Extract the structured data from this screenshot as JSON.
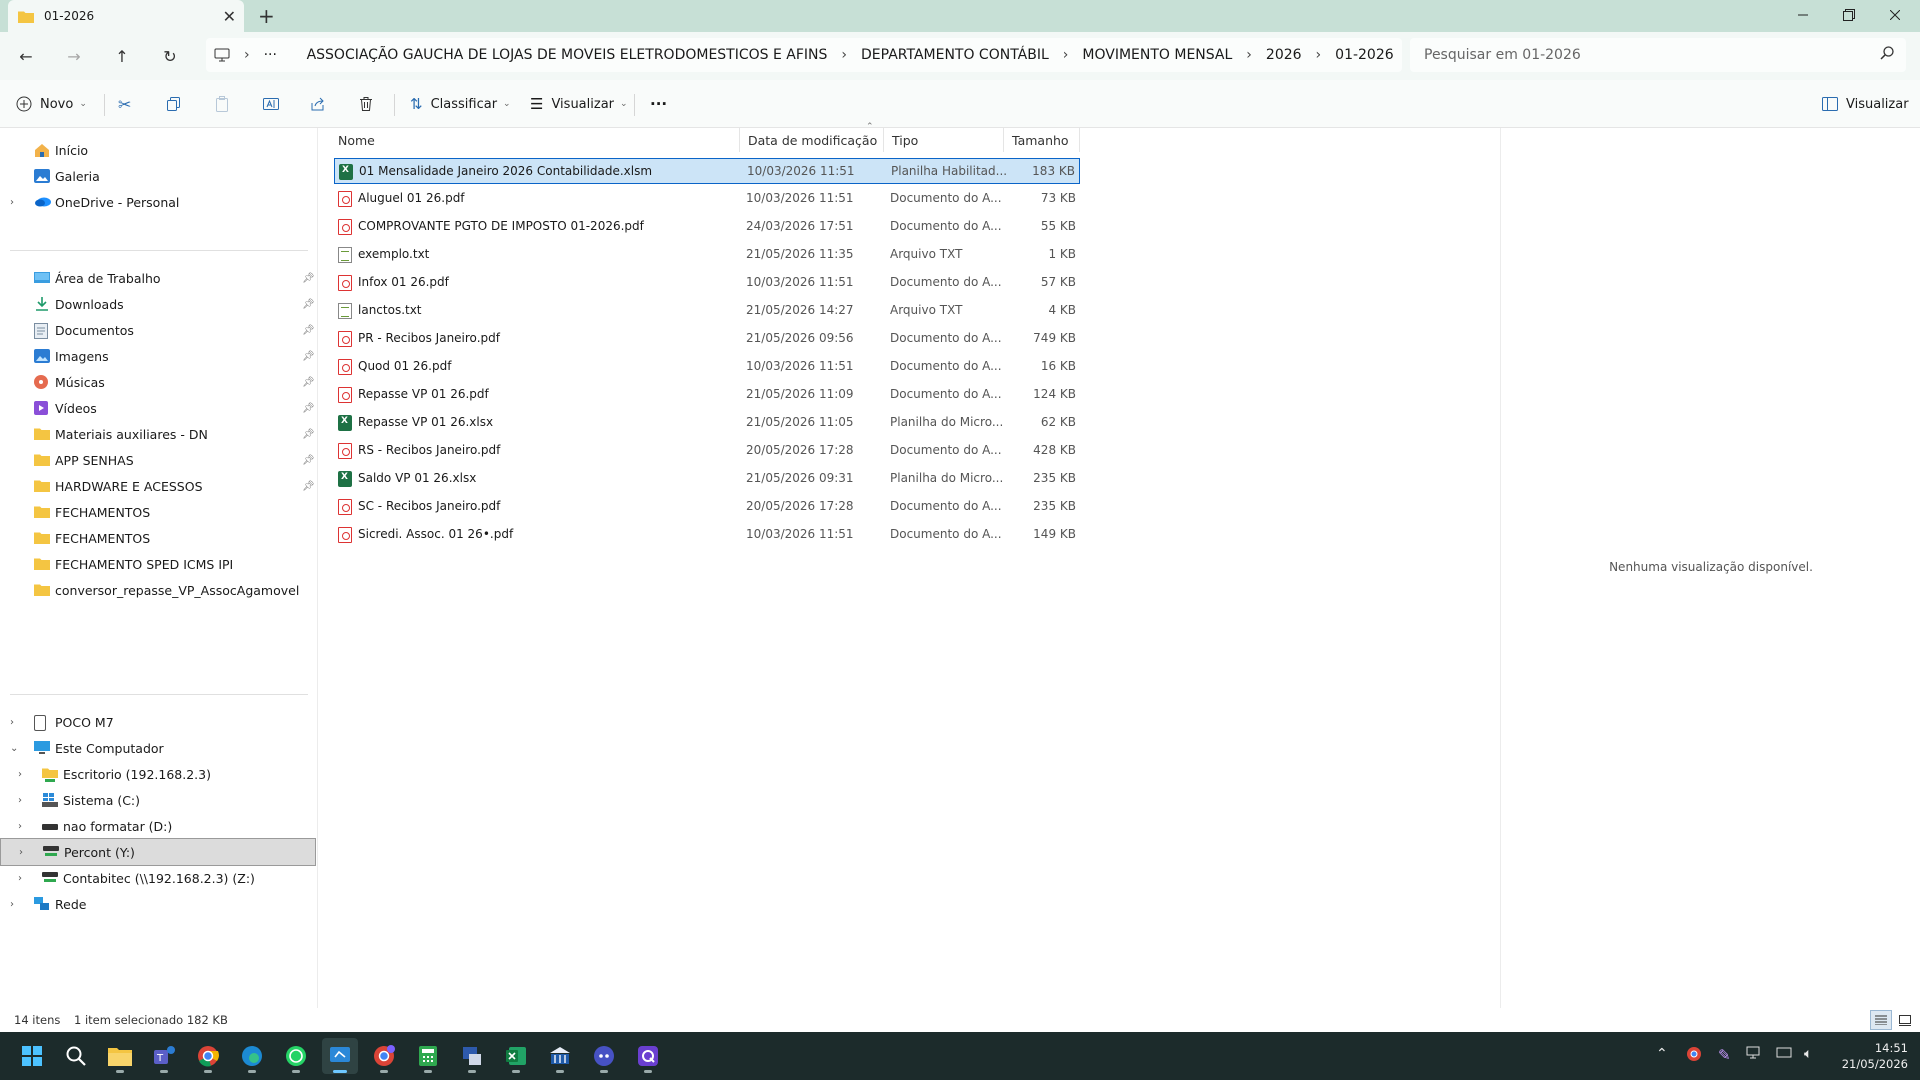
{
  "tab": {
    "title": "01-2026"
  },
  "address": {
    "crumbs": [
      "ASSOCIAÇÃO GAUCHA DE LOJAS DE MOVEIS ELETRODOMESTICOS E AFINS",
      "DEPARTAMENTO CONTÁBIL",
      "MOVIMENTO MENSAL",
      "2026",
      "01-2026"
    ],
    "ellipsis": "···"
  },
  "search": {
    "placeholder": "Pesquisar em 01-2026"
  },
  "toolbar": {
    "new_label": "Novo",
    "sort_label": "Classificar",
    "view_label": "Visualizar",
    "more_label": "···",
    "preview_label": "Visualizar"
  },
  "sidebar": {
    "top": [
      {
        "label": "Início",
        "icon": "home-icon"
      },
      {
        "label": "Galeria",
        "icon": "gallery-icon"
      },
      {
        "label": "OneDrive - Personal",
        "icon": "onedrive-icon"
      }
    ],
    "quick": [
      {
        "label": "Área de Trabalho",
        "icon": "desktop-icon",
        "pinned": true
      },
      {
        "label": "Downloads",
        "icon": "download-icon",
        "pinned": true
      },
      {
        "label": "Documentos",
        "icon": "documents-icon",
        "pinned": true
      },
      {
        "label": "Imagens",
        "icon": "pictures-icon",
        "pinned": true
      },
      {
        "label": "Músicas",
        "icon": "music-icon",
        "pinned": true
      },
      {
        "label": "Vídeos",
        "icon": "videos-icon",
        "pinned": true
      },
      {
        "label": "Materiais auxiliares - DN",
        "icon": "folder-icon",
        "pinned": true
      },
      {
        "label": "APP SENHAS",
        "icon": "folder-icon",
        "pinned": true
      },
      {
        "label": "HARDWARE E ACESSOS",
        "icon": "folder-icon",
        "pinned": true
      },
      {
        "label": "FECHAMENTOS",
        "icon": "folder-icon",
        "pinned": false
      },
      {
        "label": "FECHAMENTOS",
        "icon": "folder-icon",
        "pinned": false
      },
      {
        "label": "FECHAMENTO SPED ICMS IPI",
        "icon": "folder-icon",
        "pinned": false
      },
      {
        "label": "conversor_repasse_VP_AssocAgamovel",
        "icon": "folder-icon",
        "pinned": false
      }
    ],
    "devices": [
      {
        "label": "POCO M7",
        "icon": "phone-icon",
        "level": 0,
        "expander": "›"
      },
      {
        "label": "Este Computador",
        "icon": "computer-icon",
        "level": 0,
        "expander": "⌄"
      },
      {
        "label": "Escritorio (192.168.2.3)",
        "icon": "network-folder-icon",
        "level": 1,
        "expander": "›"
      },
      {
        "label": "Sistema (C:)",
        "icon": "windows-drive-icon",
        "level": 1,
        "expander": "›"
      },
      {
        "label": "nao formatar (D:)",
        "icon": "drive-icon",
        "level": 1,
        "expander": "›"
      },
      {
        "label": "Percont (Y:)",
        "icon": "network-drive-icon",
        "level": 1,
        "expander": "›"
      },
      {
        "label": "Contabitec (\\\\192.168.2.3) (Z:)",
        "icon": "network-drive-icon",
        "level": 1,
        "expander": "›"
      },
      {
        "label": "Rede",
        "icon": "network-icon",
        "level": 0,
        "expander": "›"
      }
    ]
  },
  "columns": {
    "name": "Nome",
    "date": "Data de modificação",
    "type": "Tipo",
    "size": "Tamanho"
  },
  "files": [
    {
      "name": "01 Mensalidade Janeiro 2026 Contabilidade.xlsm",
      "date": "10/03/2026 11:51",
      "type": "Planilha Habilitad...",
      "size": "183 KB",
      "kind": "xls"
    },
    {
      "name": "Aluguel 01 26.pdf",
      "date": "10/03/2026 11:51",
      "type": "Documento do A...",
      "size": "73 KB",
      "kind": "pdf"
    },
    {
      "name": "COMPROVANTE PGTO DE IMPOSTO 01-2026.pdf",
      "date": "24/03/2026 17:51",
      "type": "Documento do A...",
      "size": "55 KB",
      "kind": "pdf"
    },
    {
      "name": "exemplo.txt",
      "date": "21/05/2026 11:35",
      "type": "Arquivo TXT",
      "size": "1 KB",
      "kind": "txt"
    },
    {
      "name": "Infox 01 26.pdf",
      "date": "10/03/2026 11:51",
      "type": "Documento do A...",
      "size": "57 KB",
      "kind": "pdf"
    },
    {
      "name": "lanctos.txt",
      "date": "21/05/2026 14:27",
      "type": "Arquivo TXT",
      "size": "4 KB",
      "kind": "txt"
    },
    {
      "name": "PR - Recibos Janeiro.pdf",
      "date": "21/05/2026 09:56",
      "type": "Documento do A...",
      "size": "749 KB",
      "kind": "pdf"
    },
    {
      "name": "Quod 01 26.pdf",
      "date": "10/03/2026 11:51",
      "type": "Documento do A...",
      "size": "16 KB",
      "kind": "pdf"
    },
    {
      "name": "Repasse VP 01 26.pdf",
      "date": "21/05/2026 11:09",
      "type": "Documento do A...",
      "size": "124 KB",
      "kind": "pdf"
    },
    {
      "name": "Repasse VP 01 26.xlsx",
      "date": "21/05/2026 11:05",
      "type": "Planilha do Micro...",
      "size": "62 KB",
      "kind": "xls"
    },
    {
      "name": "RS - Recibos Janeiro.pdf",
      "date": "20/05/2026 17:28",
      "type": "Documento do A...",
      "size": "428 KB",
      "kind": "pdf"
    },
    {
      "name": "Saldo VP 01 26.xlsx",
      "date": "21/05/2026 09:31",
      "type": "Planilha do Micro...",
      "size": "235 KB",
      "kind": "xls"
    },
    {
      "name": "SC - Recibos Janeiro.pdf",
      "date": "20/05/2026 17:28",
      "type": "Documento do A...",
      "size": "235 KB",
      "kind": "pdf"
    },
    {
      "name": "Sicredi. Assoc. 01 26•.pdf",
      "date": "10/03/2026 11:51",
      "type": "Documento do A...",
      "size": "149 KB",
      "kind": "pdf"
    }
  ],
  "preview": {
    "message": "Nenhuma visualização disponível."
  },
  "status": {
    "count": "14 itens",
    "selection": "1 item selecionado  182 KB"
  },
  "taskbar": {
    "apps": [
      "start-icon",
      "search-icon",
      "file-explorer-icon",
      "teams-icon",
      "chrome-icon",
      "edge-icon",
      "whatsapp-icon",
      "remote-desktop-icon",
      "chrome-profile-icon",
      "calculator-icon",
      "tax-program-icon",
      "excel-icon",
      "government-app-icon",
      "discord-icon",
      "app-q-icon"
    ],
    "active_app": "remote-desktop-icon",
    "time": "14:51",
    "date": "21/05/2026"
  },
  "colors": {
    "titlebar": "#c7e0d6",
    "selection": "#cce4f7",
    "selection_border": "#0a64c8",
    "taskbar": "#1c2b2b",
    "folder": "#f4c542"
  }
}
